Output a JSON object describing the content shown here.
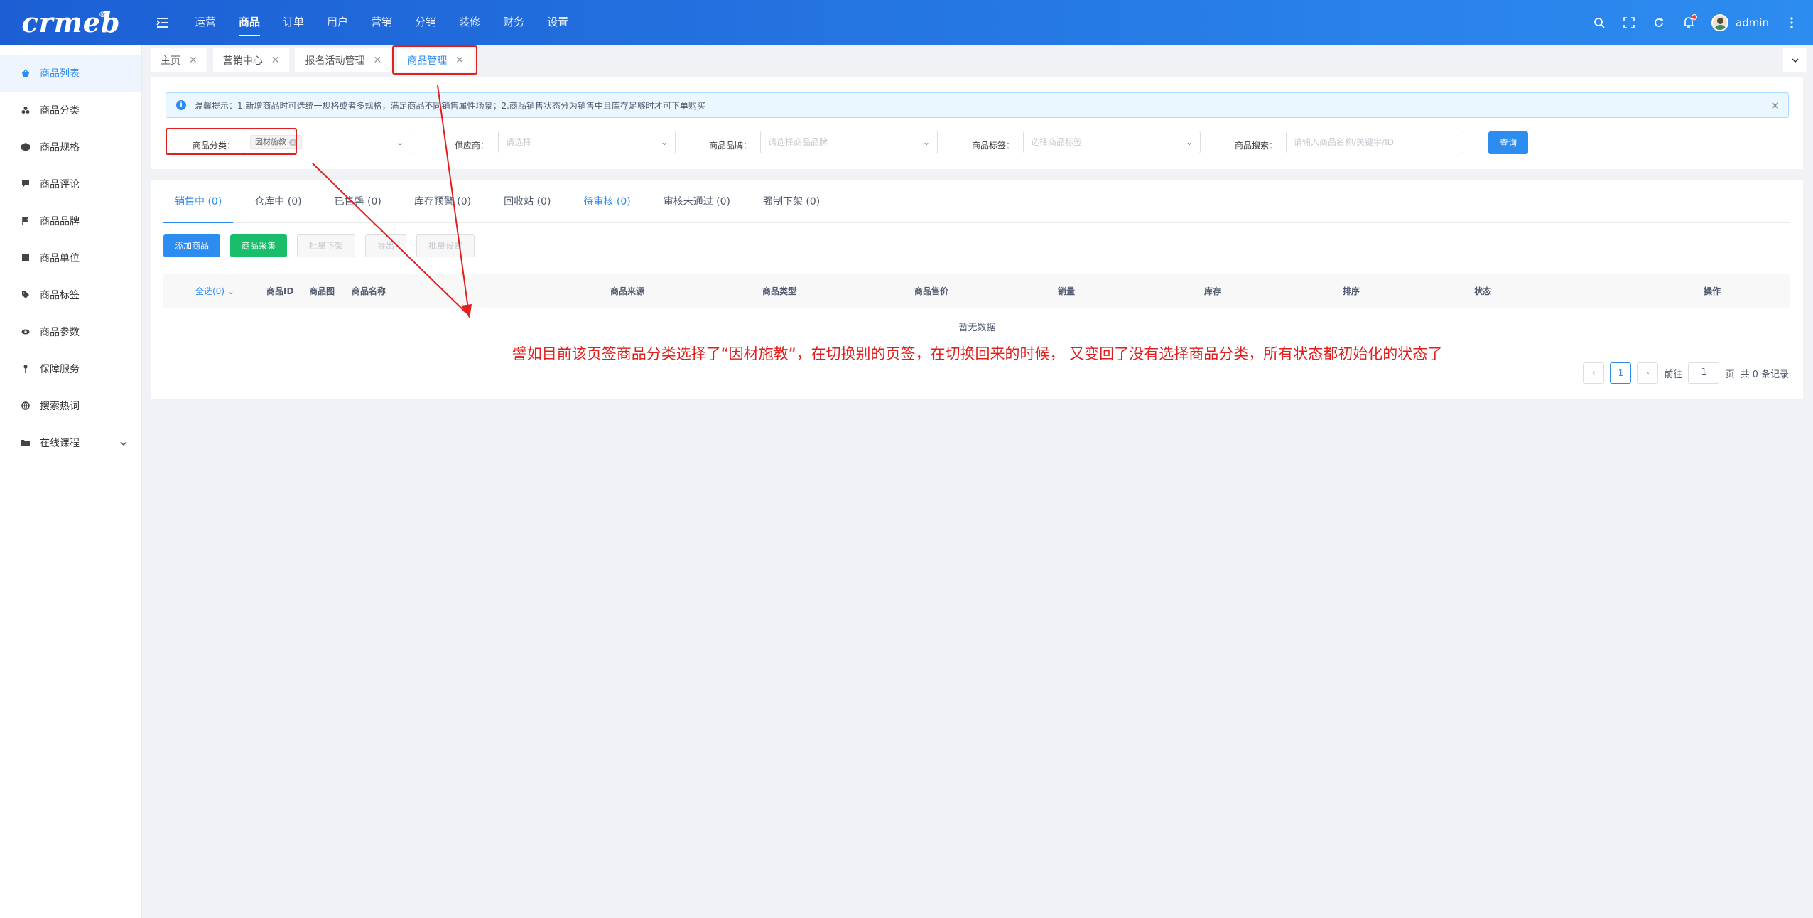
{
  "brand": {
    "logo": "crmeb"
  },
  "nav": {
    "items": [
      "运营",
      "商品",
      "订单",
      "用户",
      "营销",
      "分销",
      "装修",
      "财务",
      "设置"
    ],
    "active_index": 1
  },
  "header": {
    "username": "admin",
    "has_notification": true
  },
  "sidebar": {
    "items": [
      {
        "label": "商品列表",
        "icon": "basket-icon",
        "active": true
      },
      {
        "label": "商品分类",
        "icon": "category-icon"
      },
      {
        "label": "商品规格",
        "icon": "cube-icon"
      },
      {
        "label": "商品评论",
        "icon": "comment-icon"
      },
      {
        "label": "商品品牌",
        "icon": "flag-icon"
      },
      {
        "label": "商品单位",
        "icon": "grid-icon"
      },
      {
        "label": "商品标签",
        "icon": "tag-icon"
      },
      {
        "label": "商品参数",
        "icon": "eye-icon"
      },
      {
        "label": "保障服务",
        "icon": "pin-icon"
      },
      {
        "label": "搜索热词",
        "icon": "globe-icon"
      },
      {
        "label": "在线课程",
        "icon": "folder-icon",
        "expandable": true
      }
    ]
  },
  "page_tabs": [
    {
      "label": "主页"
    },
    {
      "label": "营销中心"
    },
    {
      "label": "报名活动管理"
    },
    {
      "label": "商品管理",
      "active": true
    }
  ],
  "alert": {
    "text": "温馨提示：1.新增商品时可选统一规格或者多规格，满足商品不同销售属性场景；2.商品销售状态分为销售中且库存足够时才可下单购买"
  },
  "filters": {
    "category": {
      "label": "商品分类：",
      "chip": "因材施教"
    },
    "supplier": {
      "label": "供应商：",
      "placeholder": "请选择"
    },
    "brand": {
      "label": "商品品牌：",
      "placeholder": "请选择商品品牌"
    },
    "tag": {
      "label": "商品标签：",
      "placeholder": "选择商品标签"
    },
    "search": {
      "label": "商品搜索：",
      "placeholder": "请输入商品名称/关键字/ID"
    },
    "query_button": "查询"
  },
  "status_tabs": [
    {
      "label": "销售中 (0)",
      "active": true
    },
    {
      "label": "仓库中 (0)"
    },
    {
      "label": "已售罄 (0)"
    },
    {
      "label": "库存预警 (0)"
    },
    {
      "label": "回收站 (0)"
    },
    {
      "label": "待审核 (0)",
      "highlight": true
    },
    {
      "label": "审核未通过 (0)"
    },
    {
      "label": "强制下架 (0)"
    }
  ],
  "actions": {
    "add": "添加商品",
    "collect": "商品采集",
    "batch_off": "批量下架",
    "export": "导出",
    "batch_set": "批量设置"
  },
  "table": {
    "select_all": "全选(0)",
    "columns": [
      "商品ID",
      "商品图",
      "商品名称",
      "商品来源",
      "商品类型",
      "商品售价",
      "销量",
      "库存",
      "排序",
      "状态",
      "操作"
    ],
    "empty_text": "暂无数据"
  },
  "annotation": "譬如目前该页签商品分类选择了“因材施教”，在切换别的页签，在切换回来的时候， 又变回了没有选择商品分类，所有状态都初始化的状态了",
  "pagination": {
    "current": "1",
    "goto_prefix": "前往",
    "goto_value": "1",
    "goto_suffix": "页",
    "total": "共 0 条记录"
  },
  "colors": {
    "primary": "#2d8cf0",
    "success": "#19be6b",
    "annotation": "#e0201e"
  }
}
